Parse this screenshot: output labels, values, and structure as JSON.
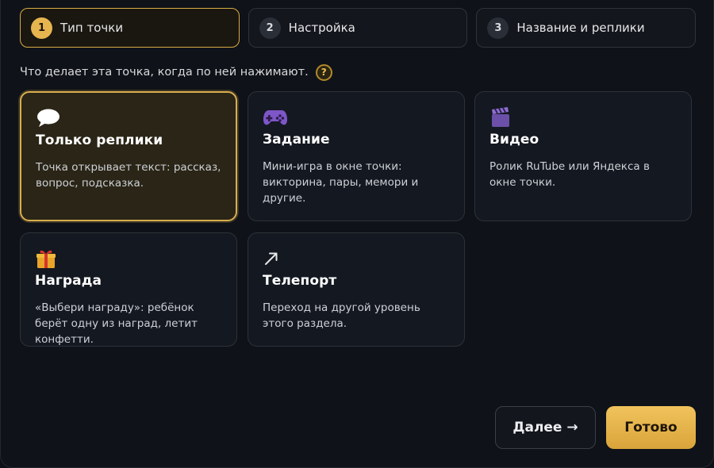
{
  "steps": [
    {
      "num": "1",
      "label": "Тип точки"
    },
    {
      "num": "2",
      "label": "Настройка"
    },
    {
      "num": "3",
      "label": "Название и реплики"
    }
  ],
  "question": {
    "text": "Что делает эта точка, когда по ней нажимают.",
    "help": "?"
  },
  "cards": [
    {
      "icon": "speech-bubble-icon",
      "title": "Только реплики",
      "desc": "Точка открывает текст: рассказ, вопрос, подсказка."
    },
    {
      "icon": "gamepad-icon",
      "title": "Задание",
      "desc": "Мини-игра в окне точки: викторина, пары, мемори и другие."
    },
    {
      "icon": "clapperboard-icon",
      "title": "Видео",
      "desc": "Ролик RuTube или Яндекса в окне точки."
    },
    {
      "icon": "gift-icon",
      "title": "Награда",
      "desc": "«Выбери награду»: ребёнок берёт одну из наград, летит конфетти."
    },
    {
      "icon": "arrow-up-right-icon",
      "title": "Телепорт",
      "desc": "Переход на другой уровень этого раздела."
    }
  ],
  "actions": {
    "next": "Далее →",
    "done": "Готово"
  },
  "colors": {
    "accent": "#e6b54f",
    "background": "#0f1218",
    "card": "#141820",
    "selected_card": "#2a2516"
  }
}
